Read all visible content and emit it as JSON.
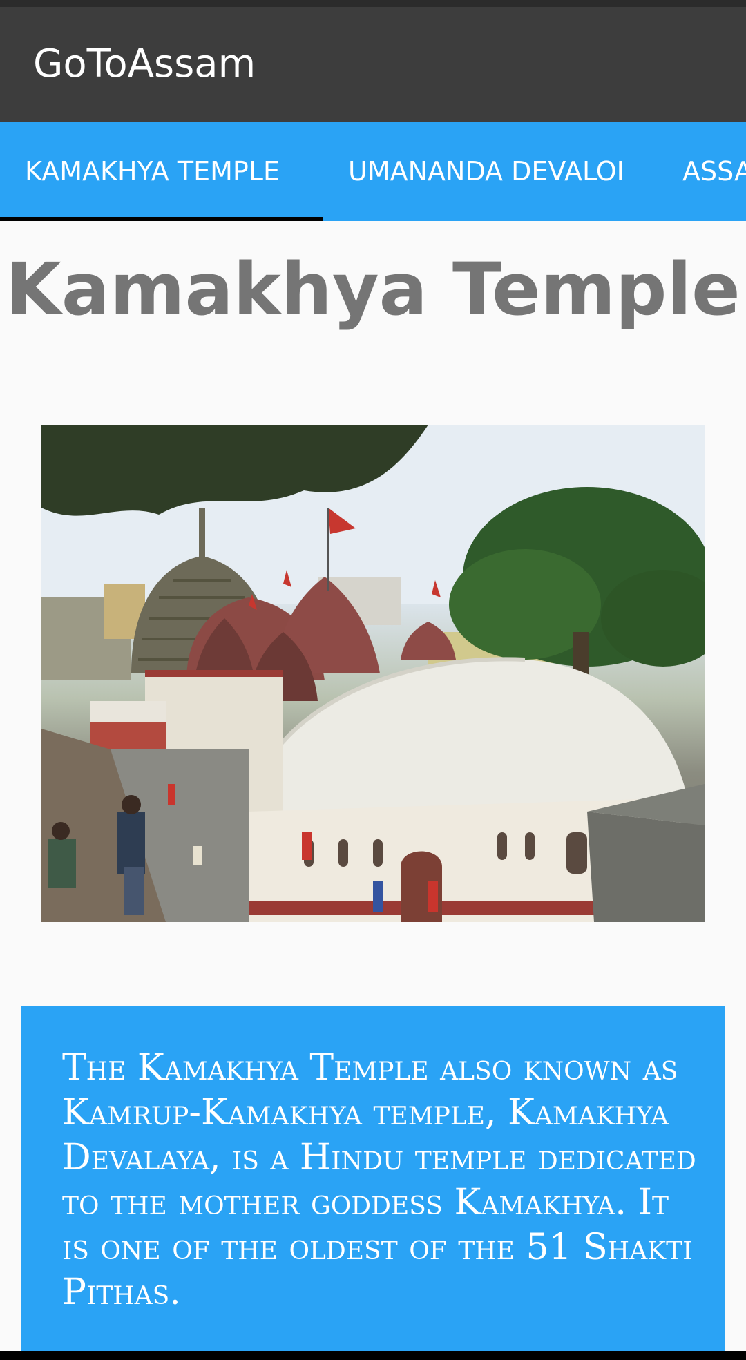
{
  "app_bar": {
    "title": "GoToAssam"
  },
  "tabs": [
    {
      "label": "KAMAKHYA TEMPLE",
      "selected": true
    },
    {
      "label": "UMANANDA DEVALOI",
      "selected": false
    },
    {
      "label": "ASSA",
      "selected": false
    }
  ],
  "main": {
    "title": "Kamakhya Temple",
    "image": {
      "subject": "kamakhya-temple-photo"
    },
    "description": "The Kamakhya Temple also known as Kamrup-Kamakhya temple, Kamakhya Devalaya, is a Hindu temple dedicated to the mother goddess Kamakhya. It is one of the oldest of the 51 Shakti Pithas."
  },
  "colors": {
    "app_bar": "#3d3d3d",
    "accent": "#2aa3f5",
    "tab_indicator": "#000000",
    "title_text": "#757575",
    "background": "#fafafa"
  }
}
